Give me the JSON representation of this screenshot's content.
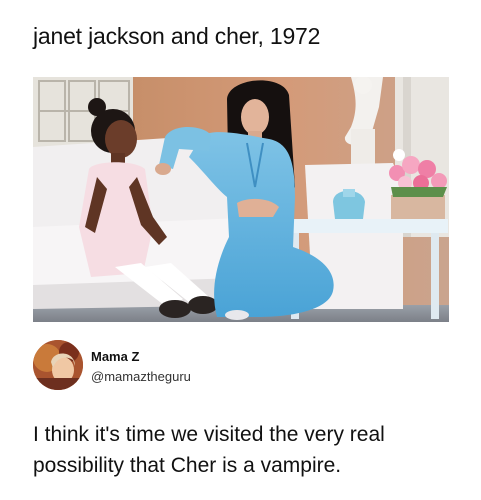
{
  "post": {
    "caption": "janet jackson and cher, 1972",
    "photo": {
      "subject": "photo-janet-jackson-and-cher"
    },
    "tweet": {
      "display_name": "Mama Z",
      "handle": "@mamaztheguru",
      "text": "I think it's time we visited the very real possibility that Cher is a vampire."
    }
  },
  "colors": {
    "text": "#111111",
    "handle_text": "#333333",
    "background": "#ffffff"
  }
}
